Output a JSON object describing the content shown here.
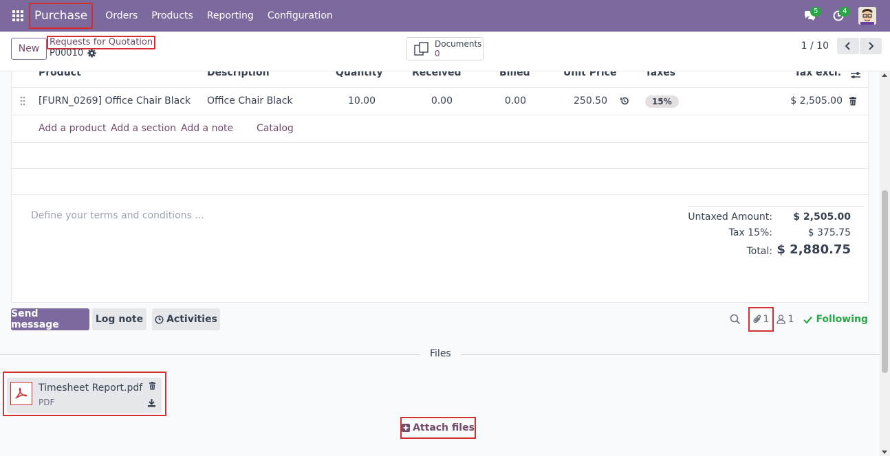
{
  "navbar": {
    "app_name": "Purchase",
    "menu": [
      "Orders",
      "Products",
      "Reporting",
      "Configuration"
    ],
    "messages_count": "5",
    "activities_count": "4"
  },
  "control": {
    "new_label": "New",
    "breadcrumb": "Requests for Quotation",
    "record": "P00010",
    "documents_label": "Documents",
    "documents_count": "0",
    "pager": "1 / 10"
  },
  "table": {
    "headers": {
      "product": "Product",
      "description": "Description",
      "quantity": "Quantity",
      "received": "Received",
      "billed": "Billed",
      "unit_price": "Unit Price",
      "taxes": "Taxes",
      "tax_excl": "Tax excl."
    },
    "line": {
      "product": "[FURN_0269] Office Chair Black",
      "description": "Office Chair Black",
      "quantity": "10.00",
      "received": "0.00",
      "billed": "0.00",
      "unit_price": "250.50",
      "tax": "15%",
      "subtotal": "$ 2,505.00"
    },
    "add_product": "Add a product",
    "add_section": "Add a section",
    "add_note": "Add a note",
    "catalog": "Catalog"
  },
  "terms_placeholder": "Define your terms and conditions ...",
  "totals": {
    "untaxed_label": "Untaxed Amount:",
    "untaxed_value": "$ 2,505.00",
    "tax_label": "Tax 15%:",
    "tax_value": "$ 375.75",
    "total_label": "Total:",
    "total_value": "$ 2,880.75"
  },
  "chatter": {
    "send_message": "Send message",
    "log_note": "Log note",
    "activities": "Activities",
    "attachments_count": "1",
    "followers_count": "1",
    "following": "Following"
  },
  "files": {
    "section_label": "Files",
    "file_name": "Timesheet Report.pdf",
    "file_type": "PDF",
    "attach_label": "Attach files"
  },
  "colors": {
    "navbar": "#7c6a9e",
    "accent": "#714b67",
    "highlight_border": "#d32f2f",
    "success": "#28a745"
  }
}
